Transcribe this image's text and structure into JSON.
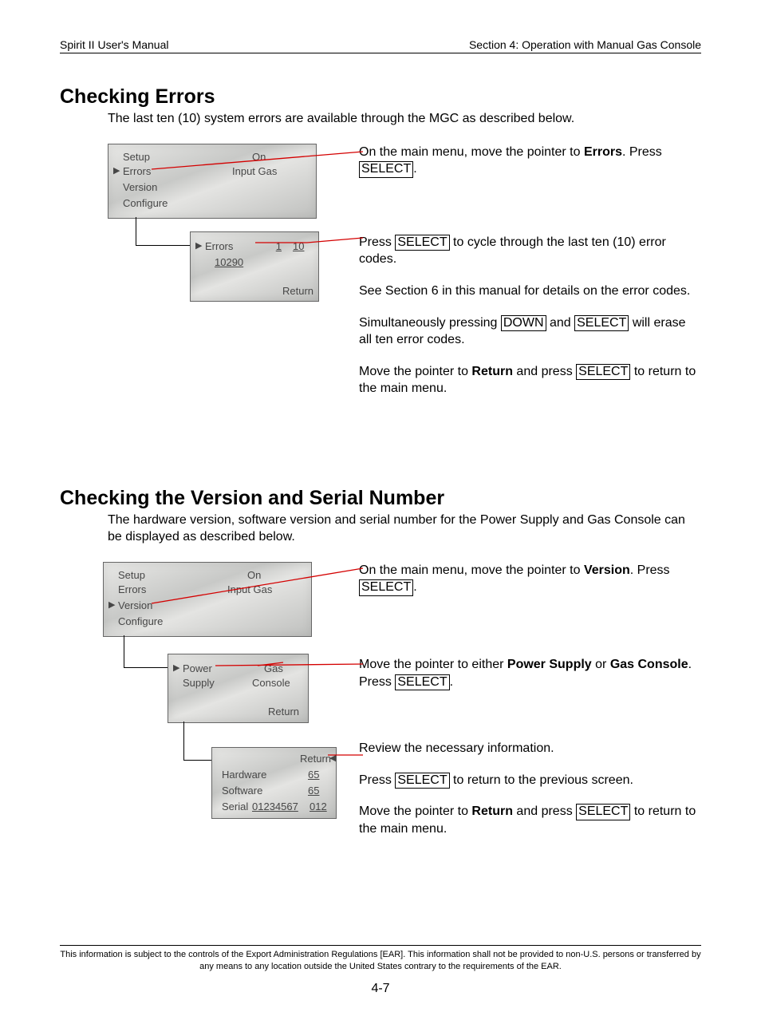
{
  "header": {
    "left": "Spirit II User's Manual",
    "right": "Section 4: Operation with Manual Gas Console"
  },
  "sec1": {
    "title": "Checking Errors",
    "intro": "The last ten (10) system errors are available through the MGC as described below.",
    "lcd1": {
      "setup": "Setup",
      "on": "On",
      "errors": "Errors",
      "input_gas": "Input Gas",
      "version": "Version",
      "configure": "Configure"
    },
    "lcd2": {
      "errors": "Errors",
      "idx": "1",
      "of": "10",
      "code": "10290",
      "return": "Return"
    },
    "p1a": "On the main menu, move the pointer to ",
    "p1b": "Errors",
    "p1c": ". Press ",
    "kSELECT": "SELECT",
    "p1d": ".",
    "p2a": "Press ",
    "p2b": " to cycle through the last ten (10) error codes.",
    "p3": "See Section 6 in this manual for details on the error codes.",
    "p4a": "Simultaneously pressing ",
    "kDOWN": "DOWN",
    "p4b": " and ",
    "p4c": " will erase all ten error codes.",
    "p5a": "Move the pointer to ",
    "p5b": "Return",
    "p5c": " and press ",
    "p5d": " to return to the main menu."
  },
  "sec2": {
    "title": "Checking the Version and Serial Number",
    "intro": "The hardware version, software version and serial number for the Power Supply and Gas Console can be displayed as described below.",
    "lcd1": {
      "setup": "Setup",
      "on": "On",
      "errors": "Errors",
      "input_gas": "Input Gas",
      "version": "Version",
      "configure": "Configure"
    },
    "lcd2": {
      "power": "Power",
      "supply": "Supply",
      "gas": "Gas",
      "console": "Console",
      "return": "Return"
    },
    "lcd3": {
      "return": "Return",
      "hardware": "Hardware",
      "hw_val": "65",
      "software": "Software",
      "sw_val": "65",
      "serial_lbl": "Serial",
      "serial_a": "01234567",
      "serial_b": "012"
    },
    "p1a": "On the main menu, move the pointer to ",
    "p1b": "Version",
    "p1c": ".  Press ",
    "p1d": ".",
    "p2a": "Move the pointer to either ",
    "p2b": "Power Supply",
    "p2c": " or ",
    "p2d": "Gas Console",
    "p2e": ".  Press ",
    "p2f": ".",
    "p3": "Review the necessary information.",
    "p4a": "Press ",
    "p4b": " to return to the previous screen.",
    "p5a": "Move the pointer to ",
    "p5b": "Return",
    "p5c": " and press ",
    "p5d": " to return to the main menu."
  },
  "footer": {
    "line": "This information is subject to the controls of the Export Administration Regulations [EAR].  This information shall not be provided to non-U.S. persons or transferred by any means to any location outside the United States contrary to the requirements of the EAR."
  },
  "page_number": "4-7"
}
